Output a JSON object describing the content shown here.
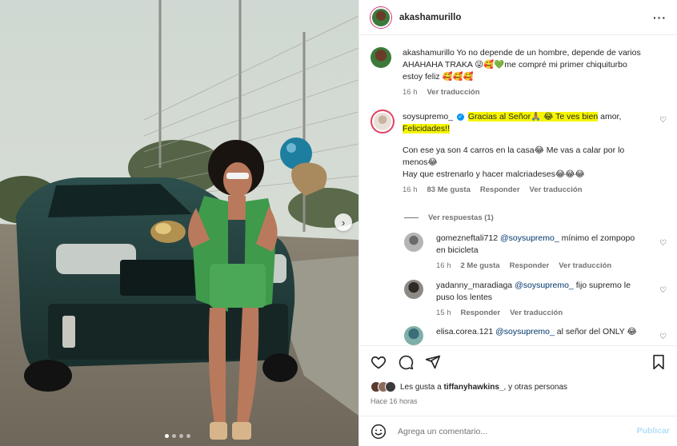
{
  "colors": {
    "accent": "#0095f6",
    "highlight": "#f5f500",
    "secondary_text": "#737373",
    "mention": "#00376b"
  },
  "header": {
    "username": "akashamurillo",
    "more_icon": "more-dots-icon"
  },
  "caption": {
    "username": "akashamurillo",
    "text": "Yo no depende de un hombre, depende de varios AHAHAHA TRAKA 😜🥰💚me compré mi primer chiquiturbo estoy feliz 🥰🥰🥰",
    "time": "16 h",
    "translate": "Ver traducción"
  },
  "comment1": {
    "username": "soysupremo_",
    "verified": true,
    "text_highlighted": "Gracias al Señor🙏🏽 😂 Te ves bien",
    "text_amor": "amor,",
    "text_hl_fe": "Fe",
    "text_licidades": "licidades!!",
    "line2": "Con ese ya son 4 carros en la casa😂 Me vas a calar por lo menos😂",
    "line3": "Hay que estrenarlo y hacer malcriadeses😂😂😂",
    "time": "16 h",
    "likes": "83 Me gusta",
    "reply": "Responder",
    "translate": "Ver traducción",
    "view_replies": "Ver respuestas (1)"
  },
  "replies": [
    {
      "username": "gomezneftali712",
      "mention": "@soysupremo_",
      "text": "mínimo el zompopo en bicicleta",
      "time": "16 h",
      "likes": "2 Me gusta",
      "reply": "Responder",
      "translate": "Ver traducción"
    },
    {
      "username": "yadanny_maradiaga",
      "mention": "@soysupremo_",
      "text": "fijo supremo le puso los lentes",
      "time": "15 h",
      "likes": "",
      "reply": "Responder",
      "translate": "Ver traducción"
    },
    {
      "username": "elisa.corea.121",
      "mention": "@soysupremo_",
      "text": "al señor del ONLY 😂",
      "time": "",
      "likes": "",
      "reply": "",
      "translate": ""
    }
  ],
  "likes": {
    "prefix": "Les gusta a",
    "user": "tiffanyhawkins_",
    "suffix": "y otras personas"
  },
  "posted_ago": "Hace 16 horas",
  "composer": {
    "placeholder": "Agrega un comentario...",
    "publish": "Publicar"
  },
  "carousel": {
    "slide_count": 4,
    "active_slide": 1
  }
}
